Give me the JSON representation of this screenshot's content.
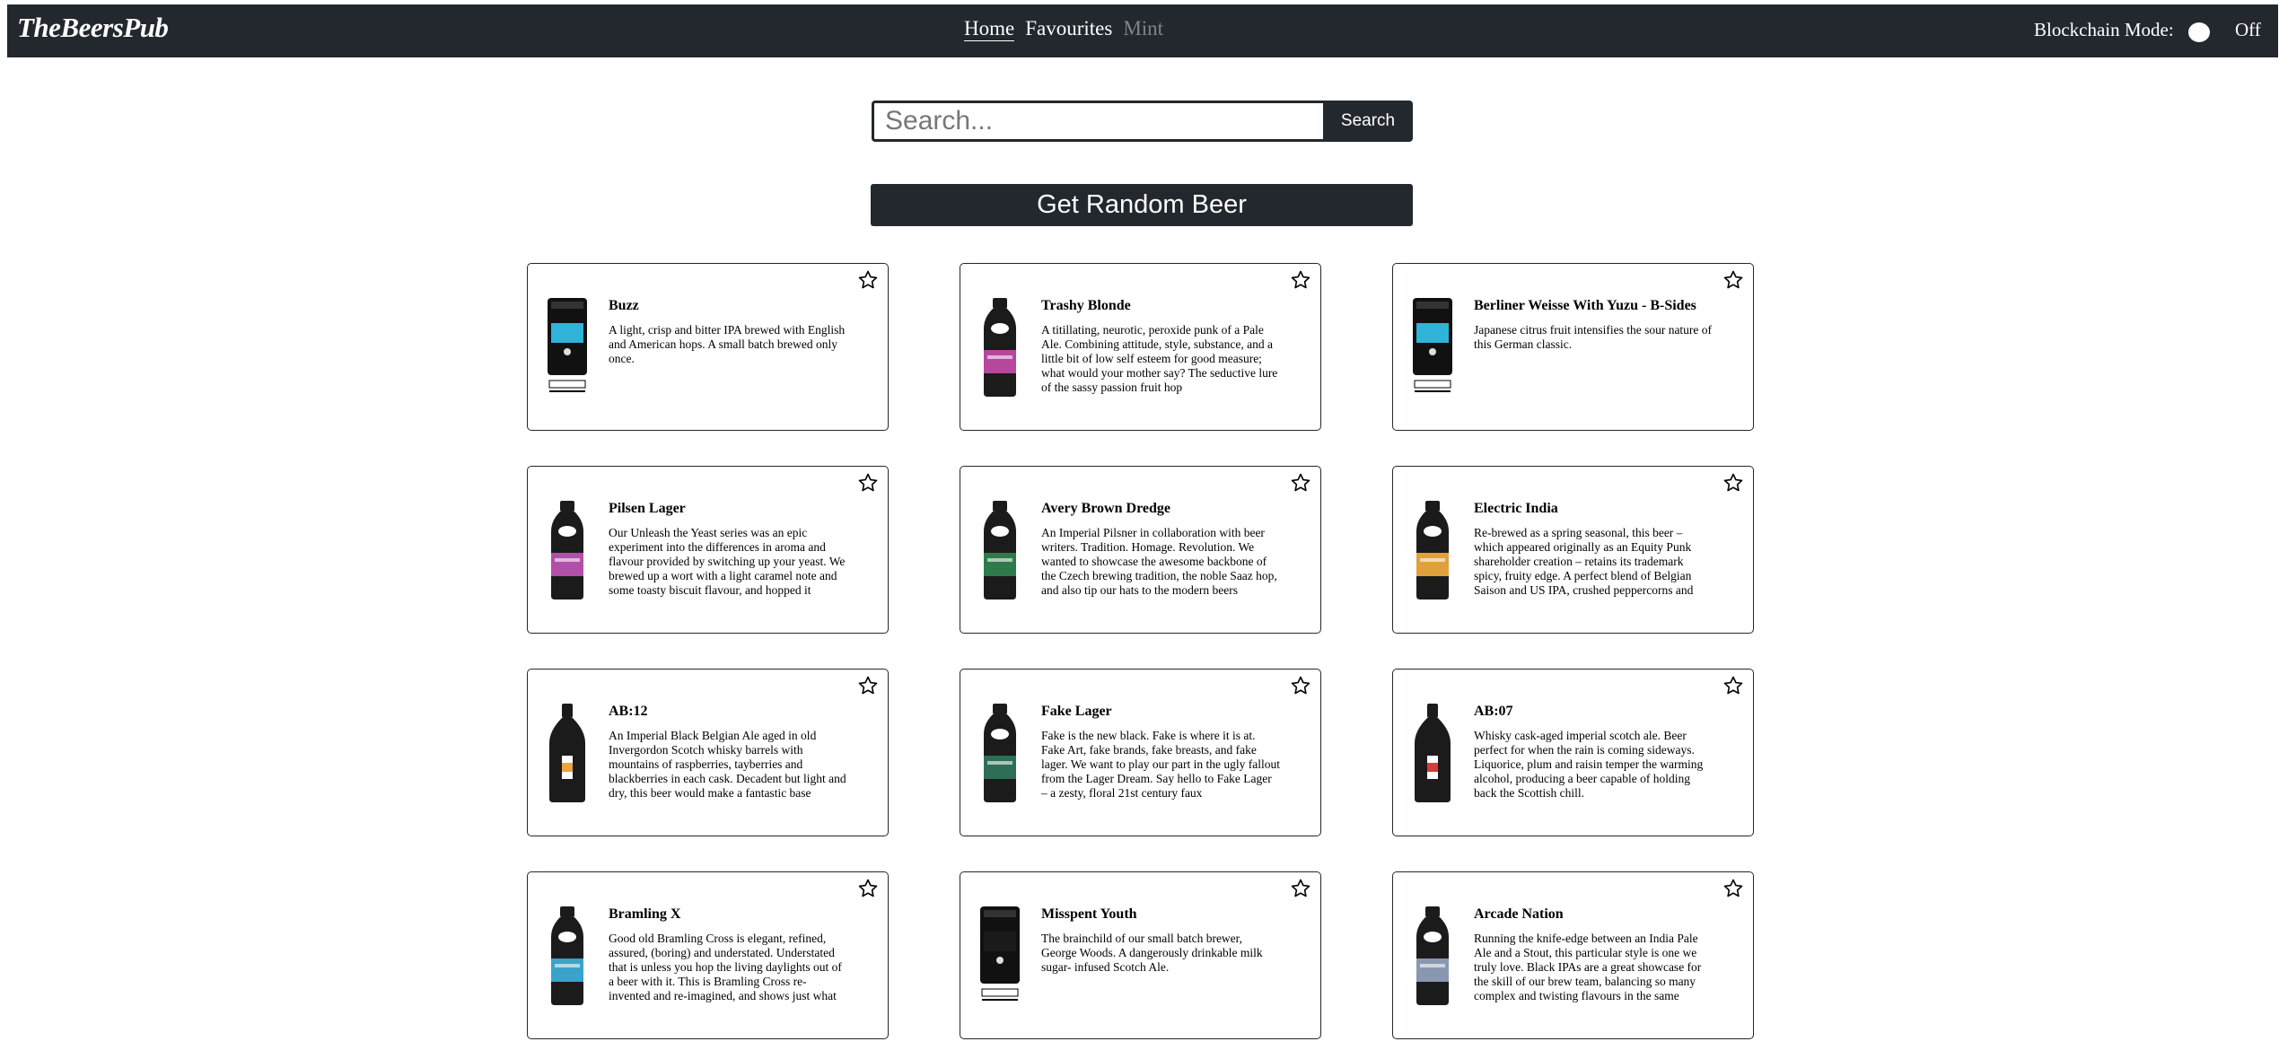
{
  "nav": {
    "brand": "TheBeersPub",
    "links": [
      "Home",
      "Favourites",
      "Mint"
    ],
    "blockchain_label": "Blockchain Mode:",
    "blockchain_state": "Off"
  },
  "search": {
    "placeholder": "Search...",
    "button_label": "Search"
  },
  "random_button": "Get Random Beer",
  "beers": [
    {
      "name": "Buzz",
      "description": "A light, crisp and bitter IPA brewed with English and American hops. A small batch brewed only once.",
      "bottle": "keg",
      "color": "#2fb3d9"
    },
    {
      "name": "Trashy Blonde",
      "description": "A titillating, neurotic, peroxide punk of a Pale Ale. Combining attitude, style, substance, and a little bit of low self esteem for good measure; what would your mother say? The seductive lure of the sassy passion fruit hop",
      "bottle": "bottle",
      "color": "#b5479c"
    },
    {
      "name": "Berliner Weisse With Yuzu - B-Sides",
      "description": "Japanese citrus fruit intensifies the sour nature of this German classic.",
      "bottle": "keg",
      "color": "#2fb3d9"
    },
    {
      "name": "Pilsen Lager",
      "description": "Our Unleash the Yeast series was an epic experiment into the differences in aroma and flavour provided by switching up your yeast. We brewed up a wort with a light caramel note and some toasty biscuit flavour, and hopped it",
      "bottle": "bottle",
      "color": "#b24fa8"
    },
    {
      "name": "Avery Brown Dredge",
      "description": "An Imperial Pilsner in collaboration with beer writers. Tradition. Homage. Revolution. We wanted to showcase the awesome backbone of the Czech brewing tradition, the noble Saaz hop, and also tip our hats to the modern beers",
      "bottle": "bottle",
      "color": "#2e7a4a"
    },
    {
      "name": "Electric India",
      "description": "Re-brewed as a spring seasonal, this beer – which appeared originally as an Equity Punk shareholder creation – retains its trademark spicy, fruity edge. A perfect blend of Belgian Saison and US IPA, crushed peppercorns and",
      "bottle": "bottle",
      "color": "#e0a13a"
    },
    {
      "name": "AB:12",
      "description": "An Imperial Black Belgian Ale aged in old Invergordon Scotch whisky barrels with mountains of raspberries, tayberries and blackberries in each cask. Decadent but light and dry, this beer would make a fantastic base",
      "bottle": "ab",
      "color": "#f2a23a"
    },
    {
      "name": "Fake Lager",
      "description": "Fake is the new black. Fake is where it is at. Fake Art, fake brands, fake breasts, and fake lager. We want to play our part in the ugly fallout from the Lager Dream. Say hello to Fake Lager – a zesty, floral 21st century faux",
      "bottle": "bottle",
      "color": "#2e6e57"
    },
    {
      "name": "AB:07",
      "description": "Whisky cask-aged imperial scotch ale. Beer perfect for when the rain is coming sideways. Liquorice, plum and raisin temper the warming alcohol, producing a beer capable of holding back the Scottish chill.",
      "bottle": "ab",
      "color": "#d93a3a"
    },
    {
      "name": "Bramling X",
      "description": "Good old Bramling Cross is elegant, refined, assured, (boring) and understated. Understated that is unless you hop the living daylights out of a beer with it. This is Bramling Cross re-invented and re-imagined, and shows just what",
      "bottle": "bottle",
      "color": "#3aa3c9"
    },
    {
      "name": "Misspent Youth",
      "description": "The brainchild of our small batch brewer, George Woods. A dangerously drinkable milk sugar- infused Scotch Ale.",
      "bottle": "keg",
      "color": "#1a1a1a"
    },
    {
      "name": "Arcade Nation",
      "description": "Running the knife-edge between an India Pale Ale and a Stout, this particular style is one we truly love. Black IPAs are a great showcase for the skill of our brew team, balancing so many complex and twisting flavours in the same",
      "bottle": "bottle",
      "color": "#8a97b0"
    }
  ]
}
